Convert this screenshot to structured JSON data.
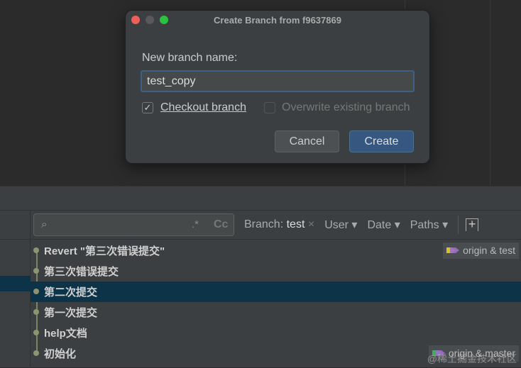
{
  "dialog": {
    "title": "Create Branch from f9637869",
    "label": "New branch name:",
    "value": "test_copy",
    "checkout_label": "Checkout branch",
    "checkout_checked": true,
    "overwrite_label": "Overwrite existing branch",
    "overwrite_checked": false,
    "cancel": "Cancel",
    "create": "Create"
  },
  "toolbar": {
    "regex": ".*",
    "case": "Cc",
    "branch_label": "Branch:",
    "branch_value": "test",
    "clear": "×",
    "user": "User ▾",
    "date": "Date ▾",
    "paths": "Paths ▾",
    "add": "+"
  },
  "commits": [
    {
      "message": "Revert \"第三次错误提交\"",
      "tag": "origin & test"
    },
    {
      "message": "第三次错误提交"
    },
    {
      "message": "第二次提交",
      "selected": true
    },
    {
      "message": "第一次提交"
    },
    {
      "message": "help文档"
    },
    {
      "message": "初始化",
      "tag": "origin & master"
    }
  ],
  "watermark": "@稀土掘金技术社区",
  "colors": {
    "selection": "#0d3349",
    "accent": "#365880"
  }
}
